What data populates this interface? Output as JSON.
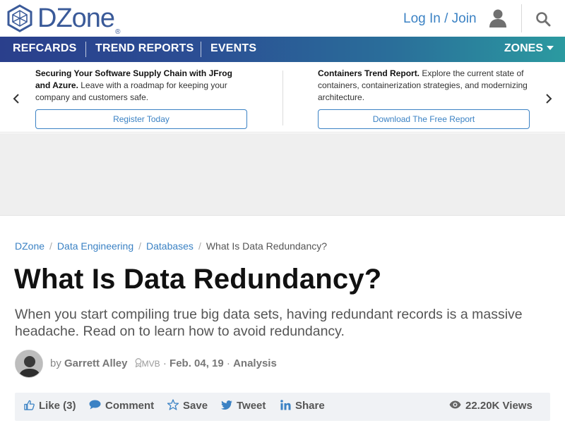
{
  "header": {
    "logo_text": "DZone",
    "logo_mark": "®",
    "login_label": "Log In / Join"
  },
  "nav": {
    "items": [
      "REFCARDS",
      "TREND REPORTS",
      "EVENTS"
    ],
    "zones_label": "ZONES"
  },
  "promo": {
    "left": {
      "title": "Securing Your Software Supply Chain with JFrog and Azure.",
      "text": "Leave with a roadmap for keeping your company and customers safe.",
      "button": "Register Today"
    },
    "right": {
      "title": "Containers Trend Report.",
      "text": "Explore the current state of containers, containerization strategies, and modernizing architecture.",
      "button": "Download The Free Report"
    }
  },
  "breadcrumb": {
    "items": [
      "DZone",
      "Data Engineering",
      "Databases"
    ],
    "current": "What Is Data Redundancy?"
  },
  "article": {
    "title": "What Is Data Redundancy?",
    "subtitle": "When you start compiling true big data sets, having redundant records is a massive headache. Read on to learn how to avoid redundancy.",
    "author_prefix": "by",
    "author": "Garrett Alley",
    "badge": "MVB",
    "date": "Feb. 04, 19",
    "category": "Analysis"
  },
  "actions": {
    "like": "Like (3)",
    "comment": "Comment",
    "save": "Save",
    "tweet": "Tweet",
    "share": "Share",
    "views": "22.20K Views"
  },
  "colors": {
    "brand": "#3a5a99",
    "link": "#3b82c4",
    "nav_start": "#2a3f8c",
    "nav_end": "#2b9aa0"
  }
}
